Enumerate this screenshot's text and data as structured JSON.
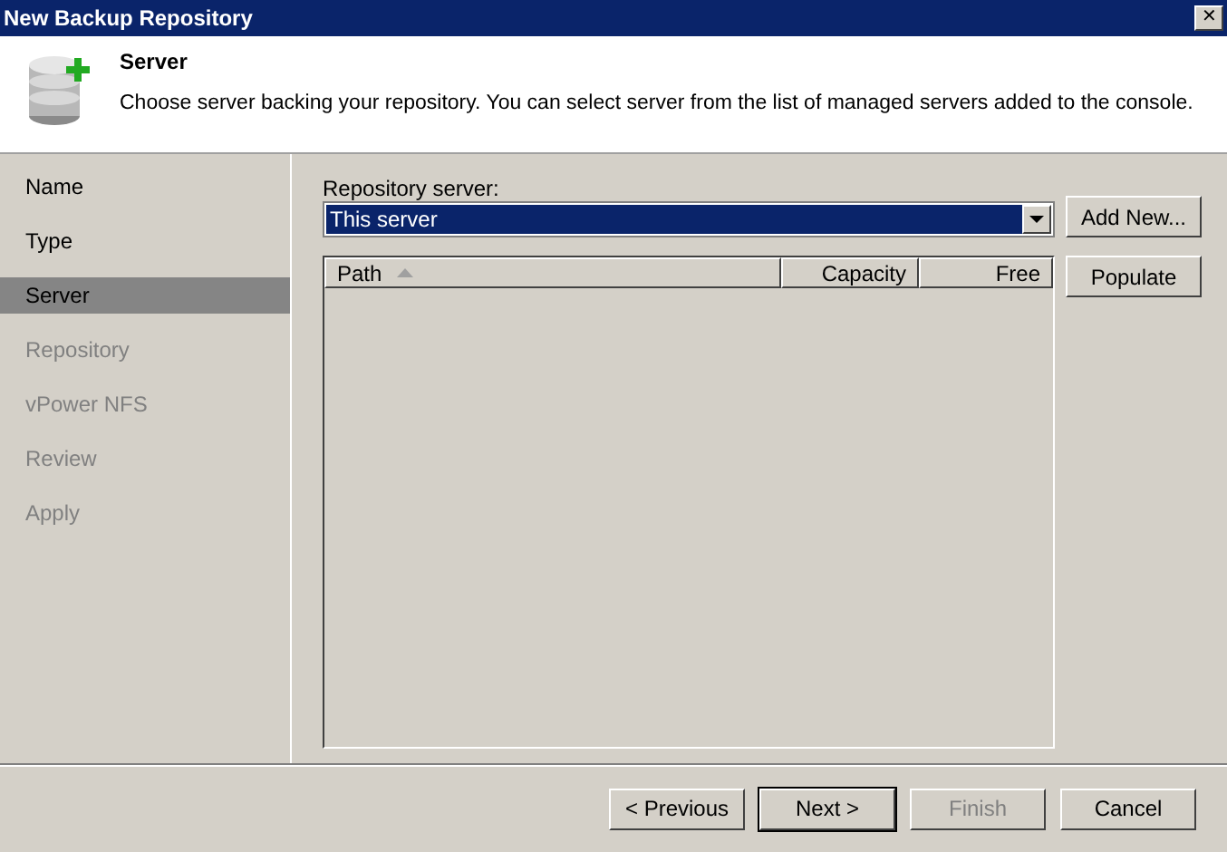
{
  "window": {
    "title": "New Backup Repository",
    "close_label": "✕"
  },
  "header": {
    "title": "Server",
    "description": "Choose server backing your repository. You can select server from the list of managed servers added to the console."
  },
  "steps": [
    {
      "label": "Name",
      "selected": false,
      "disabled": false
    },
    {
      "label": "Type",
      "selected": false,
      "disabled": false
    },
    {
      "label": "Server",
      "selected": true,
      "disabled": false
    },
    {
      "label": "Repository",
      "selected": false,
      "disabled": true
    },
    {
      "label": "vPower NFS",
      "selected": false,
      "disabled": true
    },
    {
      "label": "Review",
      "selected": false,
      "disabled": true
    },
    {
      "label": "Apply",
      "selected": false,
      "disabled": true
    }
  ],
  "server_field": {
    "label": "Repository server:",
    "value": "This server"
  },
  "side_buttons": [
    "Add New...",
    "Populate"
  ],
  "table": {
    "columns": [
      {
        "label": "Path",
        "sorted": true
      },
      {
        "label": "Capacity",
        "sorted": false
      },
      {
        "label": "Free",
        "sorted": false
      }
    ]
  },
  "buttons": [
    {
      "label": "< Previous",
      "default": false,
      "disabled": false
    },
    {
      "label": "Next >",
      "default": true,
      "disabled": false
    },
    {
      "label": "Finish",
      "default": false,
      "disabled": true
    },
    {
      "label": "Cancel",
      "default": false,
      "disabled": false
    }
  ]
}
